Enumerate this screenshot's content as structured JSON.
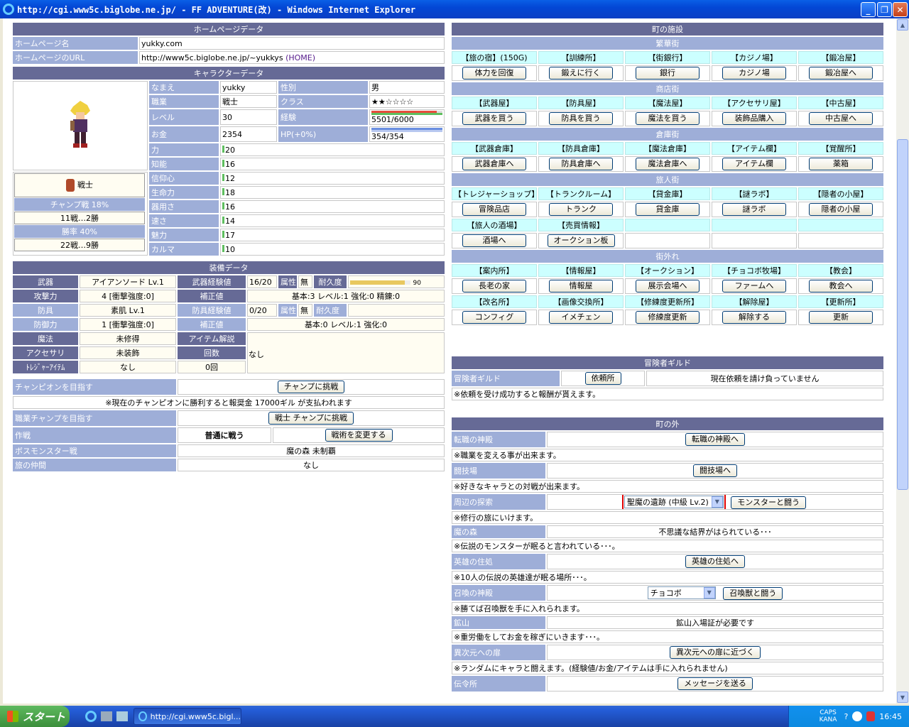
{
  "window": {
    "title": "http://cgi.www5c.biglobe.ne.jp/ - FF ADVENTURE(改) - Windows Internet Explorer"
  },
  "homepage": {
    "header": "ホームページデータ",
    "name_label": "ホームページ名",
    "name_value": "yukky.com",
    "url_label": "ホームページのURL",
    "url_value": "http://www5c.biglobe.ne.jp/~yukkys",
    "home_link": "(HOME)"
  },
  "character": {
    "header": "キャラクターデータ",
    "name_label": "なまえ",
    "name": "yukky",
    "sex_label": "性別",
    "sex": "男",
    "job_label": "職業",
    "job": "戦士",
    "class_label": "クラス",
    "class_stars": "★★☆☆☆☆",
    "level_label": "レベル",
    "level": "30",
    "exp_label": "経験",
    "exp": "5501/6000",
    "exp_ratio": 0.917,
    "gold_label": "お金",
    "gold": "2354",
    "hp_label": "HP(+0%)",
    "hp": "354/354",
    "hp_ratio": 1.0,
    "job_name": "戦士",
    "champ_label": "チャンプ戦 18%",
    "champ_record": "11戦…2勝",
    "win_label": "勝率 40%",
    "win_record": "22戦…9勝",
    "stats": [
      {
        "label": "力",
        "value": "20"
      },
      {
        "label": "知能",
        "value": "16"
      },
      {
        "label": "信仰心",
        "value": "12"
      },
      {
        "label": "生命力",
        "value": "18"
      },
      {
        "label": "器用さ",
        "value": "16"
      },
      {
        "label": "速さ",
        "value": "14"
      },
      {
        "label": "魅力",
        "value": "17"
      },
      {
        "label": "カルマ",
        "value": "10"
      }
    ]
  },
  "equipment": {
    "header": "装備データ",
    "weapon_label": "武器",
    "weapon": "アイアンソード Lv.1",
    "wexp_label": "武器経験値",
    "wexp": "16/20",
    "attr_label": "属性",
    "wattr": "無",
    "dur_label": "耐久度",
    "wdur": "90",
    "wdur_ratio": 0.9,
    "atk_label": "攻撃力",
    "atk": "4 [衝撃強度:0]",
    "corr_label": "補正値",
    "wcorr": "基本:3 レベル:1 強化:0 精錬:0",
    "armor_label": "防具",
    "armor": "素肌 Lv.1",
    "aexp_label": "防具経験値",
    "aexp": "0/20",
    "aattr": "無",
    "def_label": "防御力",
    "def": "1 [衝撃強度:0]",
    "acorr": "基本:0 レベル:1 強化:0",
    "magic_label": "魔法",
    "magic": "未修得",
    "item_label": "アイテム解説",
    "acc_label": "アクセサリ",
    "acc": "未装飾",
    "count_label": "回数",
    "count_text": "なし",
    "treasure_label": "ﾄﾚｼﾞｬｰｱｲﾃﾑ",
    "treasure": "なし",
    "treasure_count": "0回"
  },
  "actions": {
    "champ_label": "チャンピオンを目指す",
    "champ_btn": "チャンプに挑戦",
    "champ_note": "※現在のチャンピオンに勝利すると報奨金 17000ギル が支払われます",
    "job_champ_label": "職業チャンプを目指す",
    "job_champ_btn": "戦士 チャンプに挑戦",
    "tactics_label": "作戦",
    "tactics": "普通に戦う",
    "tactics_btn": "戦術を変更する",
    "boss_label": "ボスモンスター戦",
    "boss": "魔の森 未制覇",
    "party_label": "旅の仲間",
    "party": "なし"
  },
  "town": {
    "header": "町の施設",
    "sections": [
      {
        "name": "繁華街",
        "rows": [
          [
            {
              "t": "【旅の宿】(150G)",
              "b": "体力を回復"
            },
            {
              "t": "【訓練所】",
              "b": "鍛えに行く"
            },
            {
              "t": "【街銀行】",
              "b": "銀行"
            },
            {
              "t": "【カジノ場】",
              "b": "カジノ場"
            },
            {
              "t": "【鍛冶屋】",
              "b": "鍛冶屋へ"
            }
          ]
        ]
      },
      {
        "name": "商店街",
        "rows": [
          [
            {
              "t": "【武器屋】",
              "b": "武器を買う"
            },
            {
              "t": "【防具屋】",
              "b": "防具を買う"
            },
            {
              "t": "【魔法屋】",
              "b": "魔法を買う"
            },
            {
              "t": "【アクセサリ屋】",
              "b": "装飾品購入"
            },
            {
              "t": "【中古屋】",
              "b": "中古屋へ"
            }
          ]
        ]
      },
      {
        "name": "倉庫街",
        "rows": [
          [
            {
              "t": "【武器倉庫】",
              "b": "武器倉庫へ"
            },
            {
              "t": "【防具倉庫】",
              "b": "防具倉庫へ"
            },
            {
              "t": "【魔法倉庫】",
              "b": "魔法倉庫へ"
            },
            {
              "t": "【アイテム欄】",
              "b": "アイテム欄"
            },
            {
              "t": "【覚醒所】",
              "b": "薬箱"
            }
          ]
        ]
      },
      {
        "name": "旅人街",
        "rows": [
          [
            {
              "t": "【トレジャーショップ】",
              "b": "冒険品店"
            },
            {
              "t": "【トランクルーム】",
              "b": "トランク"
            },
            {
              "t": "【貸金庫】",
              "b": "貸金庫"
            },
            {
              "t": "【謎ラボ】",
              "b": "謎ラボ"
            },
            {
              "t": "【隠者の小屋】",
              "b": "隠者の小屋"
            }
          ],
          [
            {
              "t": "【旅人の酒場】",
              "b": "酒場へ"
            },
            {
              "t": "【売買情報】",
              "b": "オークション板"
            },
            {
              "t": "",
              "b": ""
            },
            {
              "t": "",
              "b": ""
            },
            {
              "t": "",
              "b": ""
            }
          ]
        ]
      },
      {
        "name": "街外れ",
        "rows": [
          [
            {
              "t": "【案内所】",
              "b": "長老の家"
            },
            {
              "t": "【情報屋】",
              "b": "情報屋"
            },
            {
              "t": "【オークション】",
              "b": "展示会場へ"
            },
            {
              "t": "【チョコボ牧場】",
              "b": "ファームへ"
            },
            {
              "t": "【教会】",
              "b": "教会へ"
            }
          ],
          [
            {
              "t": "【改名所】",
              "b": "コンフィグ"
            },
            {
              "t": "【画像交換所】",
              "b": "イメチェン"
            },
            {
              "t": "【修練度更新所】",
              "b": "修練度更新"
            },
            {
              "t": "【解除屋】",
              "b": "解除する"
            },
            {
              "t": "【更新所】",
              "b": "更新"
            }
          ]
        ]
      }
    ]
  },
  "guild": {
    "header": "冒険者ギルド",
    "label": "冒険者ギルド",
    "btn": "依頼所",
    "status": "現在依頼を請け負っていません",
    "note": "※依頼を受け成功すると報酬が貰えます。"
  },
  "outside": {
    "header": "町の外",
    "temple_label": "転職の神殿",
    "temple_btn": "転職の神殿へ",
    "temple_note": "※職業を変える事が出来ます。",
    "arena_label": "闘技場",
    "arena_btn": "闘技場へ",
    "arena_note": "※好きなキャラとの対戦が出来ます。",
    "explore_label": "周辺の探索",
    "explore_select": "聖魔の遺跡 (中級 Lv.2)",
    "explore_btn": "モンスターと闘う",
    "explore_note": "※修行の旅にいけます。",
    "forest_label": "魔の森",
    "forest_text": "不思議な結界がはられている･･･",
    "forest_note": "※伝説のモンスターが眠ると言われている･･･。",
    "hero_label": "英雄の住処",
    "hero_btn": "英雄の住処へ",
    "hero_note": "※10人の伝説の英雄達が眠る場所･･･。",
    "summon_label": "召喚の神殿",
    "summon_select": "チョコボ",
    "summon_btn": "召喚獣と闘う",
    "summon_note": "※勝てば召喚獣を手に入れられます。",
    "mine_label": "鉱山",
    "mine_text": "鉱山入場証が必要です",
    "mine_note": "※重労働をしてお金を稼ぎにいきます･･･。",
    "dim_label": "異次元への扉",
    "dim_btn": "異次元への扉に近づく",
    "dim_note": "※ランダムにキャラと闘えます。(経験値/お金/アイテムは手に入れられません)",
    "msg_label": "伝令所",
    "msg_btn": "メッセージを送る"
  },
  "taskbar": {
    "start": "スタート",
    "task": "http://cgi.www5c.bigl...",
    "time": "16:45",
    "caps": "CAPS",
    "kana": "KANA"
  },
  "colors": {
    "header": "#666a96",
    "label": "#9eaed8",
    "facility": "#ccffff",
    "value": "#fffdf2"
  }
}
